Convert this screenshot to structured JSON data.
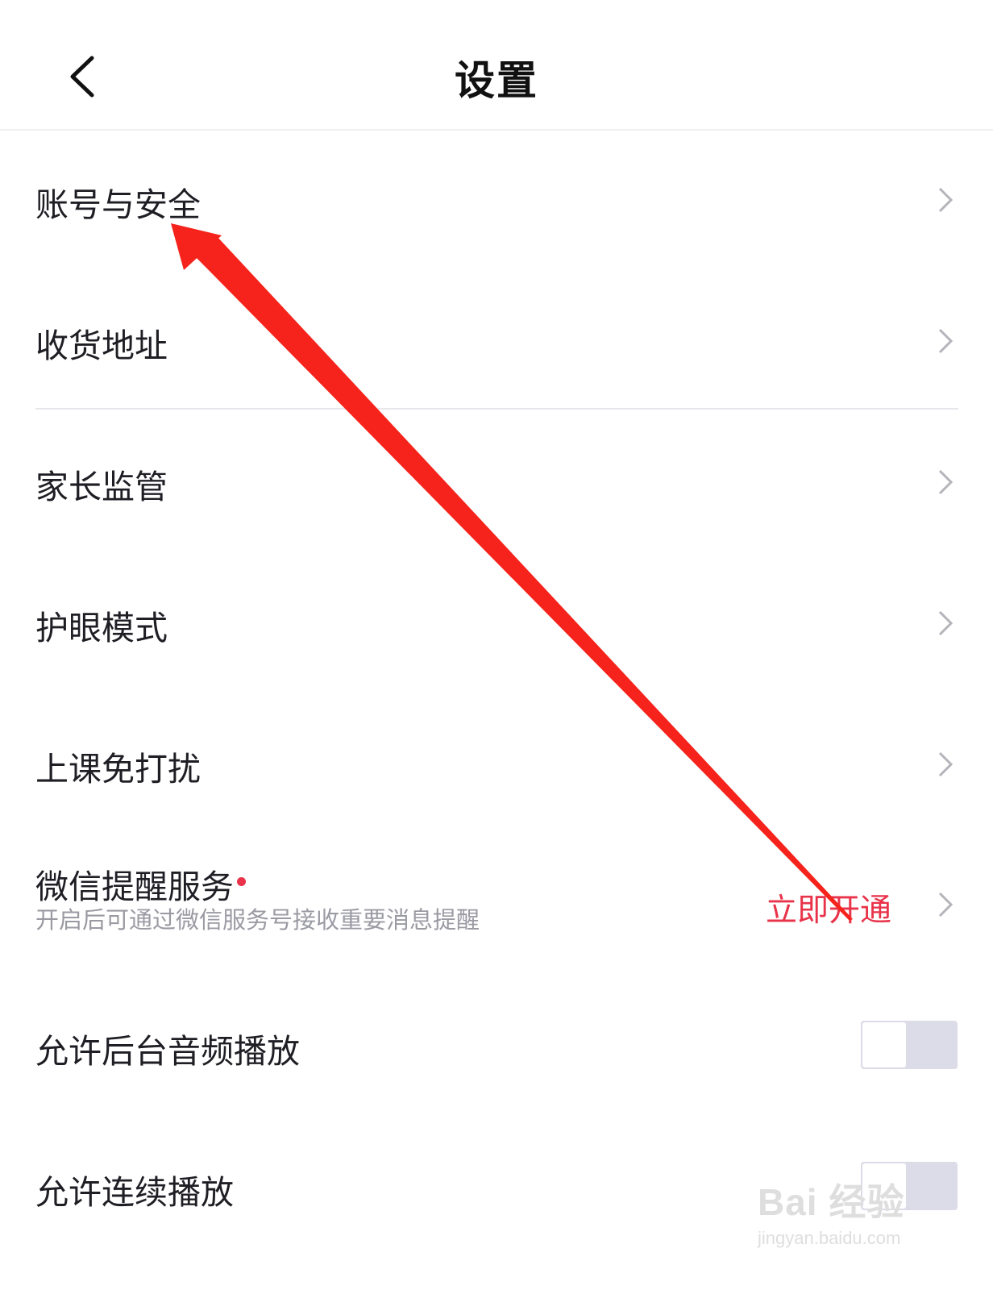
{
  "header": {
    "title": "设置",
    "back_icon": "chevron-left-icon"
  },
  "settings": {
    "account_security": "账号与安全",
    "shipping_address": "收货地址",
    "parental_control": "家长监管",
    "eye_protection": "护眼模式",
    "class_dnd": "上课免打扰",
    "wechat_reminder": {
      "label": "微信提醒服务",
      "sublabel": "开启后可通过微信服务号接收重要消息提醒",
      "action": "立即开通"
    },
    "background_audio": {
      "label": "允许后台音频播放",
      "enabled": false
    },
    "autoplay": {
      "label": "允许连续播放",
      "enabled": false
    }
  },
  "colors": {
    "accent_red": "#e8334a",
    "annotation_red": "#f5231b",
    "toggle_off": "#dcdbe8"
  },
  "watermark": {
    "brand": "Bai 经验",
    "url": "jingyan.baidu.com"
  }
}
